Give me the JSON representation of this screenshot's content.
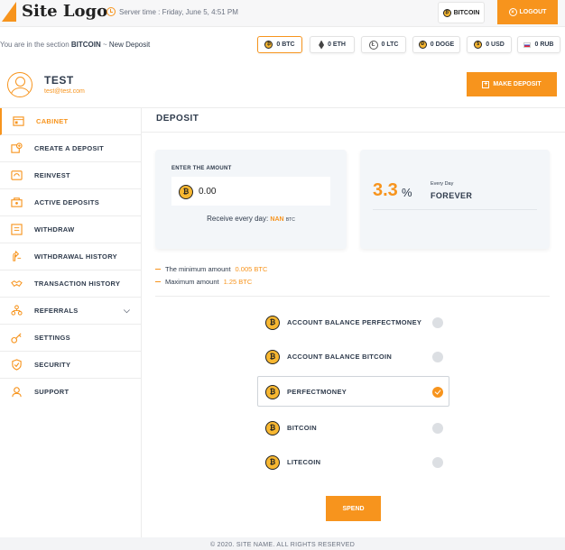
{
  "header": {
    "logo_text": "Site Logo",
    "server_time": "Server time : Friday, June 5, 4:51 PM",
    "currency": "BITCOIN",
    "logout_label": "LOGOUT"
  },
  "subheader": {
    "prefix": "You are in the section",
    "section": "BITCOIN",
    "separator": " ~ ",
    "page": "New Deposit",
    "currency_tabs": [
      {
        "label": "0 BTC",
        "icon": "bitcoin-icon",
        "active": true
      },
      {
        "label": "0 ETH",
        "icon": "ethereum-icon",
        "active": false
      },
      {
        "label": "0 LTC",
        "icon": "litecoin-icon",
        "active": false
      },
      {
        "label": "0 DOGE",
        "icon": "dogecoin-icon",
        "active": false
      },
      {
        "label": "0 USD",
        "icon": "usd-coin-icon",
        "active": false
      },
      {
        "label": "0 RUB",
        "icon": "rub-flag-icon",
        "active": false
      }
    ]
  },
  "user": {
    "name": "TEST",
    "email": "test@test.com",
    "make_deposit_label": "MAKE DEPOSIT"
  },
  "sidebar": {
    "items": [
      {
        "label": "CABINET",
        "icon": "cabinet-icon",
        "active": true
      },
      {
        "label": "CREATE A DEPOSIT",
        "icon": "create-deposit-icon",
        "active": false
      },
      {
        "label": "REINVEST",
        "icon": "reinvest-icon",
        "active": false
      },
      {
        "label": "ACTIVE DEPOSITS",
        "icon": "active-deposits-icon",
        "active": false
      },
      {
        "label": "WITHDRAW",
        "icon": "withdraw-icon",
        "active": false
      },
      {
        "label": "WITHDRAWAL HISTORY",
        "icon": "withdrawal-history-icon",
        "active": false
      },
      {
        "label": "TRANSACTION HISTORY",
        "icon": "handshake-icon",
        "active": false
      },
      {
        "label": "REFERRALS",
        "icon": "referrals-icon",
        "active": false
      },
      {
        "label": "SETTINGS",
        "icon": "key-icon",
        "active": false
      },
      {
        "label": "SECURITY",
        "icon": "shield-icon",
        "active": false
      },
      {
        "label": "SUPPORT",
        "icon": "support-icon",
        "active": false
      }
    ]
  },
  "deposit": {
    "title": "DEPOSIT",
    "enter_amount_label": "ENTER THE AMOUNT",
    "amount_value": "0.00",
    "receive_label": "Receive every day:",
    "receive_value": "NAN",
    "receive_unit": "BTC",
    "rate": "3.3",
    "rate_unit": "%",
    "period_top": "Every Day",
    "period_main": "FOREVER",
    "min_label": "The minimum amount",
    "min_value": "0.005 BTC",
    "max_label": "Maximum amount",
    "max_value": "1.25 BTC",
    "payment_options": [
      {
        "label": "ACCOUNT BALANCE PERFECTMONEY",
        "selected": false
      },
      {
        "label": "ACCOUNT BALANCE BITCOIN",
        "selected": false
      },
      {
        "label": "PERFECTMONEY",
        "selected": true
      },
      {
        "label": "BITCOIN",
        "selected": false
      },
      {
        "label": "LITECOIN",
        "selected": false
      }
    ],
    "spend_label": "SPEND"
  },
  "footer": {
    "text": "© 2020. SITE NAME. ALL RIGHTS RESERVED"
  },
  "colors": {
    "accent": "#f7941d",
    "text": "#2f3b4c",
    "card": "#f3f6f9"
  }
}
